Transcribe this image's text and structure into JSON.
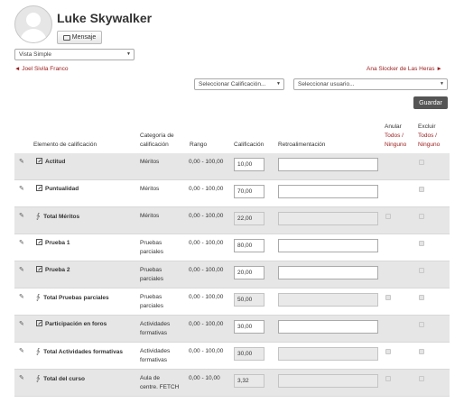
{
  "user": {
    "name": "Luke Skywalker",
    "message_label": "Mensaje"
  },
  "view_select": {
    "value": "Vista Simple"
  },
  "nav": {
    "prev": "◄ Joel Sivila Franco",
    "next": "Ana Slocker de Las Heras ►"
  },
  "filters": {
    "grade_select": "Seleccionar Calificación...",
    "user_select": "Seleccionar usuario..."
  },
  "actions": {
    "save": "Guardar"
  },
  "headers": {
    "item": "Elemento de calificación",
    "category_l1": "Categoría de",
    "category_l2": "calificación",
    "range": "Rango",
    "grade": "Calificación",
    "feedback": "Retroalimentación",
    "override": "Anular",
    "exclude": "Excluir",
    "all_none": "Todos / Ninguno",
    "all": "Todos /",
    "none": "Ninguno"
  },
  "rows": [
    {
      "item": "Actitud",
      "cat1": "Méritos",
      "cat2": "",
      "range": "0,00 - 100,00",
      "grade": "10,00"
    },
    {
      "item": "Puntualidad",
      "cat1": "Méritos",
      "cat2": "",
      "range": "0,00 - 100,00",
      "grade": "70,00"
    },
    {
      "item": "Total Méritos",
      "cat1": "Méritos",
      "cat2": "",
      "range": "0,00 - 100,00",
      "grade": "22,00"
    },
    {
      "item": "Prueba 1",
      "cat1": "Pruebas",
      "cat2": "parciales",
      "range": "0,00 - 100,00",
      "grade": "80,00"
    },
    {
      "item": "Prueba 2",
      "cat1": "Pruebas",
      "cat2": "parciales",
      "range": "0,00 - 100,00",
      "grade": "20,00"
    },
    {
      "item": "Total Pruebas parciales",
      "cat1": "Pruebas",
      "cat2": "parciales",
      "range": "0,00 - 100,00",
      "grade": "50,00"
    },
    {
      "item": "Participación en foros",
      "cat1": "Actividades",
      "cat2": "formativas",
      "range": "0,00 - 100,00",
      "grade": "30,00"
    },
    {
      "item": "Total Actividades formativas",
      "cat1": "Actividades",
      "cat2": "formativas",
      "range": "0,00 - 100,00",
      "grade": "30,00"
    },
    {
      "item": "Total del curso",
      "cat1": "Aula de",
      "cat2": "centre. FETCH",
      "range": "0,00 - 10,00",
      "grade": "3,32"
    }
  ]
}
